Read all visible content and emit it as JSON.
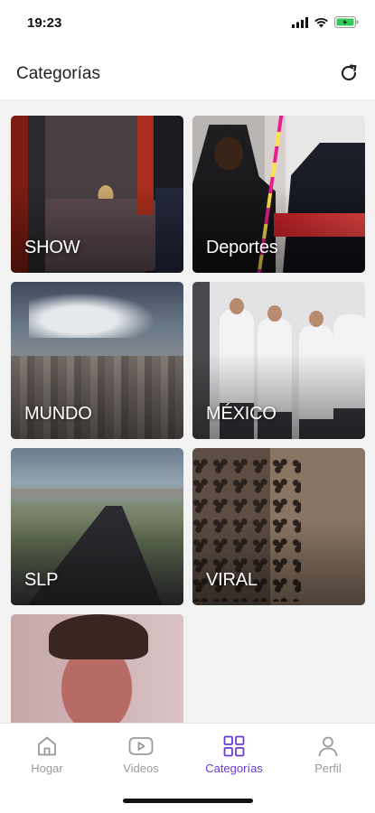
{
  "status": {
    "time": "19:23"
  },
  "header": {
    "title": "Categorías"
  },
  "categories": [
    {
      "label": "SHOW"
    },
    {
      "label": "Deportes"
    },
    {
      "label": "MUNDO"
    },
    {
      "label": "MÉXICO"
    },
    {
      "label": "SLP"
    },
    {
      "label": "VIRAL"
    },
    {
      "label": ""
    }
  ],
  "tabs": [
    {
      "label": "Hogar",
      "icon": "home-icon"
    },
    {
      "label": "Videos",
      "icon": "video-icon"
    },
    {
      "label": "Categorías",
      "icon": "grid-icon"
    },
    {
      "label": "Perfil",
      "icon": "user-icon"
    }
  ],
  "colors": {
    "accent": "#6a3ad4",
    "inactive": "#9a9a9a"
  }
}
